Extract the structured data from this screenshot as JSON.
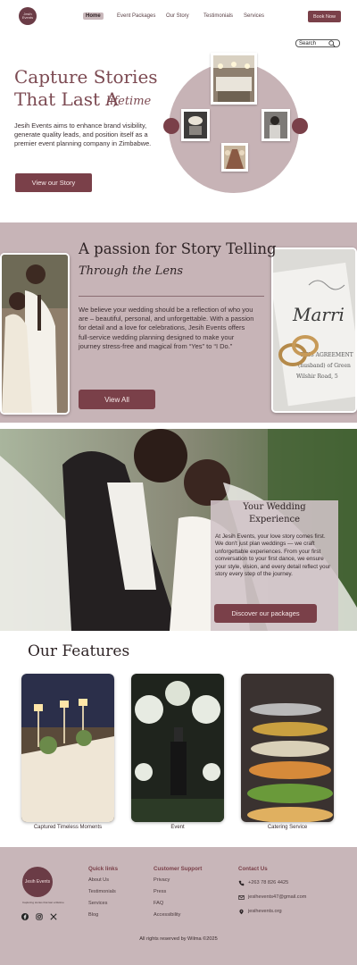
{
  "nav": {
    "logo_text": "Jesih Events",
    "links": [
      "Home",
      "Event Packages",
      "Our Story",
      "Testimonials",
      "Services"
    ],
    "book_label": "Book Now",
    "search_placeholder": "Search"
  },
  "hero": {
    "title_line1": "Capture Stories",
    "title_line2": "That Last A",
    "title_script": "lifetime",
    "text": "Jesih Events aims to enhance brand visibility, generate quality leads, and position itself as a premier event planning company in Zimbabwe.",
    "button": "View our Story"
  },
  "story": {
    "title": "A passion for Story Telling",
    "script": "Through the Lens",
    "text": "We believe your wedding should be a reflection of who you are – beautiful, personal, and unforgettable. With a passion for detail and a love for celebrations, Jesih Events offers full-service wedding planning designed to make your journey stress-free and magical from “Yes” to “I Do.”",
    "button": "View All"
  },
  "experience": {
    "title_line1": "Your Wedding",
    "title_line2": "Experience",
    "text": "At Jesih Events, your love story comes first. We don't just plan weddings — we craft unforgettable experiences. From your first conversation to your first dance, we ensure your style, vision, and every detail reflect your story every step of the journey.",
    "button": "Discover our packages"
  },
  "features": {
    "title": "Our Features",
    "items": [
      "Captured Timeless Moments",
      "Event",
      "Catering Service"
    ]
  },
  "footer": {
    "logo_text": "Jesih Events",
    "tagline": "Capturing stories that last a lifetime",
    "quick_links_title": "Quick links",
    "quick_links": [
      "About Us",
      "Testimonials",
      "Services",
      "Blog"
    ],
    "support_title": "Customer Support",
    "support_links": [
      "Privacy",
      "Press",
      "FAQ",
      "Accessibility"
    ],
    "contact_title": "Contact Us",
    "phone": "+263 78 826 4425",
    "email": "jesihevents47@gmail.com",
    "website": "jesihevents.org",
    "copyright": "All rights reserved by Wilma ©2025"
  },
  "colors": {
    "accent": "#7a4049",
    "band": "#c7b4b7"
  }
}
